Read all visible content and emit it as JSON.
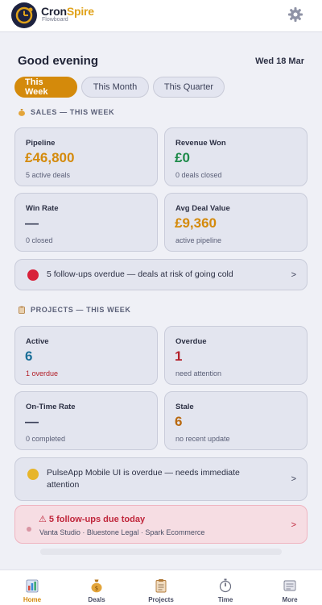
{
  "app": {
    "name_part1": "Cron",
    "name_part2": "Spire",
    "subtitle": "Flowboard"
  },
  "greeting": "Good evening",
  "date": "Wed 18 Mar",
  "periods": [
    {
      "label": "This Week",
      "active": true
    },
    {
      "label": "This Month",
      "active": false
    },
    {
      "label": "This Quarter",
      "active": false
    }
  ],
  "sales": {
    "heading": "SALES — THIS WEEK",
    "cards": [
      {
        "label": "Pipeline",
        "value": "£46,800",
        "sub": "5 active deals"
      },
      {
        "label": "Revenue Won",
        "value": "£0",
        "sub": "0 deals closed"
      },
      {
        "label": "Win Rate",
        "value": "—",
        "sub": "0 closed"
      },
      {
        "label": "Avg Deal Value",
        "value": "£9,360",
        "sub": "active pipeline"
      }
    ],
    "alert": {
      "text": "5 follow-ups overdue — deals at risk of going cold",
      "chevron": ">"
    }
  },
  "projects": {
    "heading": "PROJECTS — THIS WEEK",
    "cards": [
      {
        "label": "Active",
        "value": "6",
        "sub": "1 overdue"
      },
      {
        "label": "Overdue",
        "value": "1",
        "sub": "need attention"
      },
      {
        "label": "On-Time Rate",
        "value": "—",
        "sub": "0 completed"
      },
      {
        "label": "Stale",
        "value": "6",
        "sub": "no recent update"
      }
    ],
    "alert": {
      "line1": "PulseApp Mobile UI is overdue — needs immediate",
      "line2": "attention",
      "chevron": ">"
    }
  },
  "followups": {
    "title": "⚠ 5 follow-ups due today",
    "names": "Vanta Studio · Bluestone Legal · Spark Ecommerce",
    "chevron": ">"
  },
  "nav": [
    {
      "label": "Home",
      "icon": "home-chart-icon",
      "active": true
    },
    {
      "label": "Deals",
      "icon": "money-bag-icon",
      "active": false
    },
    {
      "label": "Projects",
      "icon": "clipboard-icon",
      "active": false
    },
    {
      "label": "Time",
      "icon": "stopwatch-icon",
      "active": false
    },
    {
      "label": "More",
      "icon": "more-panel-icon",
      "active": false
    }
  ],
  "colors": {
    "accent": "#d48a0b",
    "green": "#1e8a4a",
    "blue": "#1b6f98",
    "red": "#b3212a",
    "brown": "#b8680e"
  }
}
